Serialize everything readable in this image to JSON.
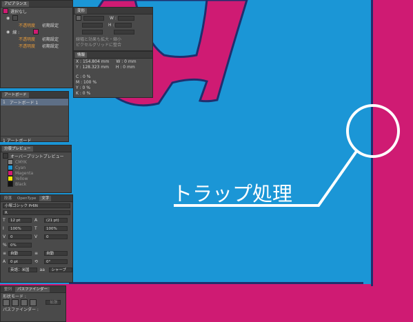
{
  "colors": {
    "blue": "#1b96d6",
    "magenta": "#cf1b73",
    "navy": "#1f2f6e",
    "panel": "#4a4a4a"
  },
  "annotation": {
    "label": "トラップ処理"
  },
  "appearance": {
    "tab": "アピアランス",
    "header": "選択なし",
    "row1_opacity": "不透明度",
    "row1_default": "初期設定",
    "stroke_label": "線 :",
    "row2_opacity": "不透明度",
    "row2_default": "初期設定",
    "row3_opacity": "不透明度",
    "row3_default": "初期設定"
  },
  "transform": {
    "tab": "変形",
    "w_label": "W :",
    "h_label": "H :",
    "opt1": "線幅と効果も拡大・縮小",
    "opt2": "ピクセルグリッドに整合"
  },
  "info": {
    "tab": "情報",
    "x": "X : 154.804 mm",
    "y": "Y : 128.323 mm",
    "w": "W : 0 mm",
    "h": "H : 0 mm",
    "c": "C : 0 %",
    "m": "M : 100 %",
    "yv": "Y : 0 %",
    "k": "K : 0 %"
  },
  "artboards": {
    "tab": "アートボード",
    "item_num": "1",
    "item_name": "アートボード 1",
    "footer": "1 アートボード"
  },
  "separations": {
    "tab": "分版プレビュー",
    "overprint": "オーバープリントプレビュー",
    "channels": [
      {
        "name": "CMYK",
        "color": "#888888"
      },
      {
        "name": "Cyan",
        "color": "#1b96d6"
      },
      {
        "name": "Magenta",
        "color": "#cf1b73"
      },
      {
        "name": "Yellow",
        "color": "#f2e300"
      },
      {
        "name": "Black",
        "color": "#111111"
      }
    ]
  },
  "character": {
    "tabs": [
      "段落",
      "OpenType",
      "文字"
    ],
    "font": "小塚ゴシック Pr6N",
    "style": "R",
    "size": "12 pt",
    "leading": "(21 pt)",
    "vscale": "100%",
    "hscale": "100%",
    "kern": "0",
    "track": "0",
    "tsume": "0%",
    "aki1": "自動",
    "aki2": "自動",
    "shift": "0 pt",
    "rotate": "0°",
    "lang": "英語：米国",
    "aa": "シャープ"
  },
  "pathfinder": {
    "tabs": [
      "整列",
      "パスファインダー"
    ],
    "mode": "形状モード :",
    "expand": "拡張",
    "label": "パスファインダー :"
  }
}
